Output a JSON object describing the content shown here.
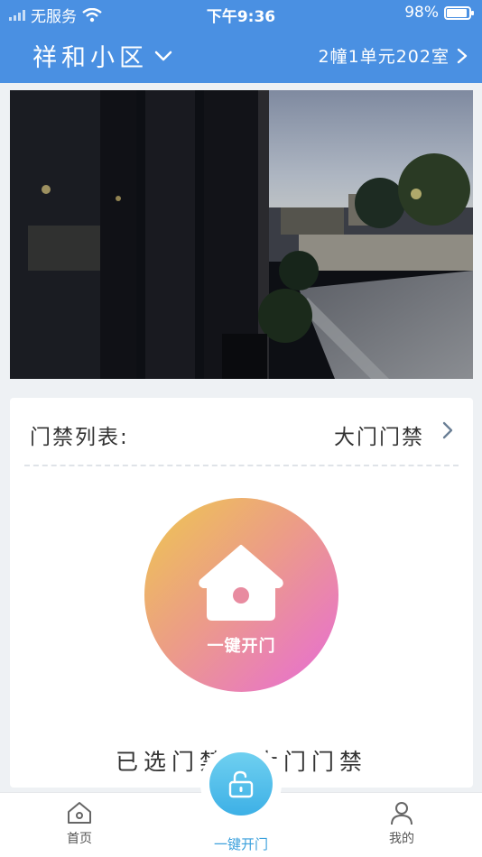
{
  "status_bar": {
    "carrier": "无服务",
    "time": "下午9:36",
    "battery": "98%"
  },
  "header": {
    "community": "祥和小区",
    "room": "2幢1单元202室"
  },
  "door_list": {
    "label": "门禁列表:",
    "value": "大门门禁"
  },
  "open_button": {
    "label": "一键开门"
  },
  "selected_text": "已选门禁：大门门禁",
  "tabbar": {
    "home": "首页",
    "open": "一键开门",
    "mine": "我的"
  },
  "icons": [
    "wifi-icon",
    "battery-icon",
    "chevron-down-icon",
    "chevron-right-icon",
    "house-icon",
    "unlock-icon",
    "home-icon",
    "user-icon"
  ],
  "colors": {
    "header": "#4a90e2",
    "accent": "#3aa0dc",
    "gradient_start": "#eec84f",
    "gradient_end": "#e76bd8"
  }
}
